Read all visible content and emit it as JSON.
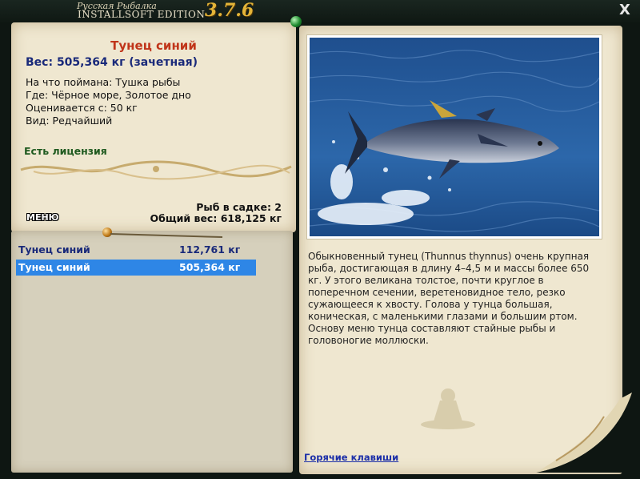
{
  "window": {
    "brand_small": "Русская Рыбалка",
    "brand_big": "INSTALLSOFT EDITION",
    "version": "3.7.6",
    "close_label": "X"
  },
  "fish": {
    "name": "Тунец синий",
    "weight": "Вес: 505,364 кг (зачетная)",
    "caught_on": "На что поймана: Тушка рыбы",
    "location": "Где: Чёрное море, Золотое дно",
    "valued_from": "Оценивается с: 50 кг",
    "kind": "Вид: Редчайший",
    "license": "Есть лицензия"
  },
  "menu_label": "МЕНЮ",
  "cage": {
    "count": "Рыб в садке: 2",
    "total": "Общий вес: 618,125 кг"
  },
  "catch_list": [
    {
      "name": "Тунец синий",
      "weight": "112,761 кг"
    },
    {
      "name": "Тунец синий",
      "weight": "505,364 кг"
    }
  ],
  "description": "Обыкновенный тунец (Thunnus thynnus) очень крупная рыба, достигающая в длину 4–4,5 м и массы более 650 кг. У этого великана толстое, почти круглое в поперечном сечении, веретеновидное тело, резко сужающееся к хвосту. Голова у тунца большая, коническая, с маленькими глазами и большим ртом. Основу меню тунца составляют стайные рыбы и головоногие моллюски.",
  "hotkeys_label": "Горячие клавиши",
  "colors": {
    "accent_title": "#c0351a",
    "weight_blue": "#1a2a7a",
    "selection": "#2e86e6",
    "license_green": "#1f5a1f",
    "version_gold": "#e4b438"
  }
}
